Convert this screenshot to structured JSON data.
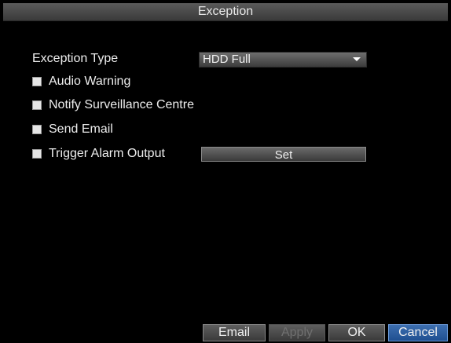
{
  "dialog": {
    "title": "Exception"
  },
  "exception_type": {
    "label": "Exception Type",
    "value": "HDD Full"
  },
  "options": [
    {
      "label": "Audio Warning",
      "checked": false
    },
    {
      "label": "Notify Surveillance Centre",
      "checked": false
    },
    {
      "label": "Send Email",
      "checked": false
    },
    {
      "label": "Trigger Alarm Output",
      "checked": false
    }
  ],
  "set_button": {
    "label": "Set"
  },
  "footer": {
    "email_label": "Email",
    "apply_label": "Apply",
    "ok_label": "OK",
    "cancel_label": "Cancel"
  },
  "colors": {
    "background": "#000000",
    "active_button": "#2a5c9e"
  }
}
